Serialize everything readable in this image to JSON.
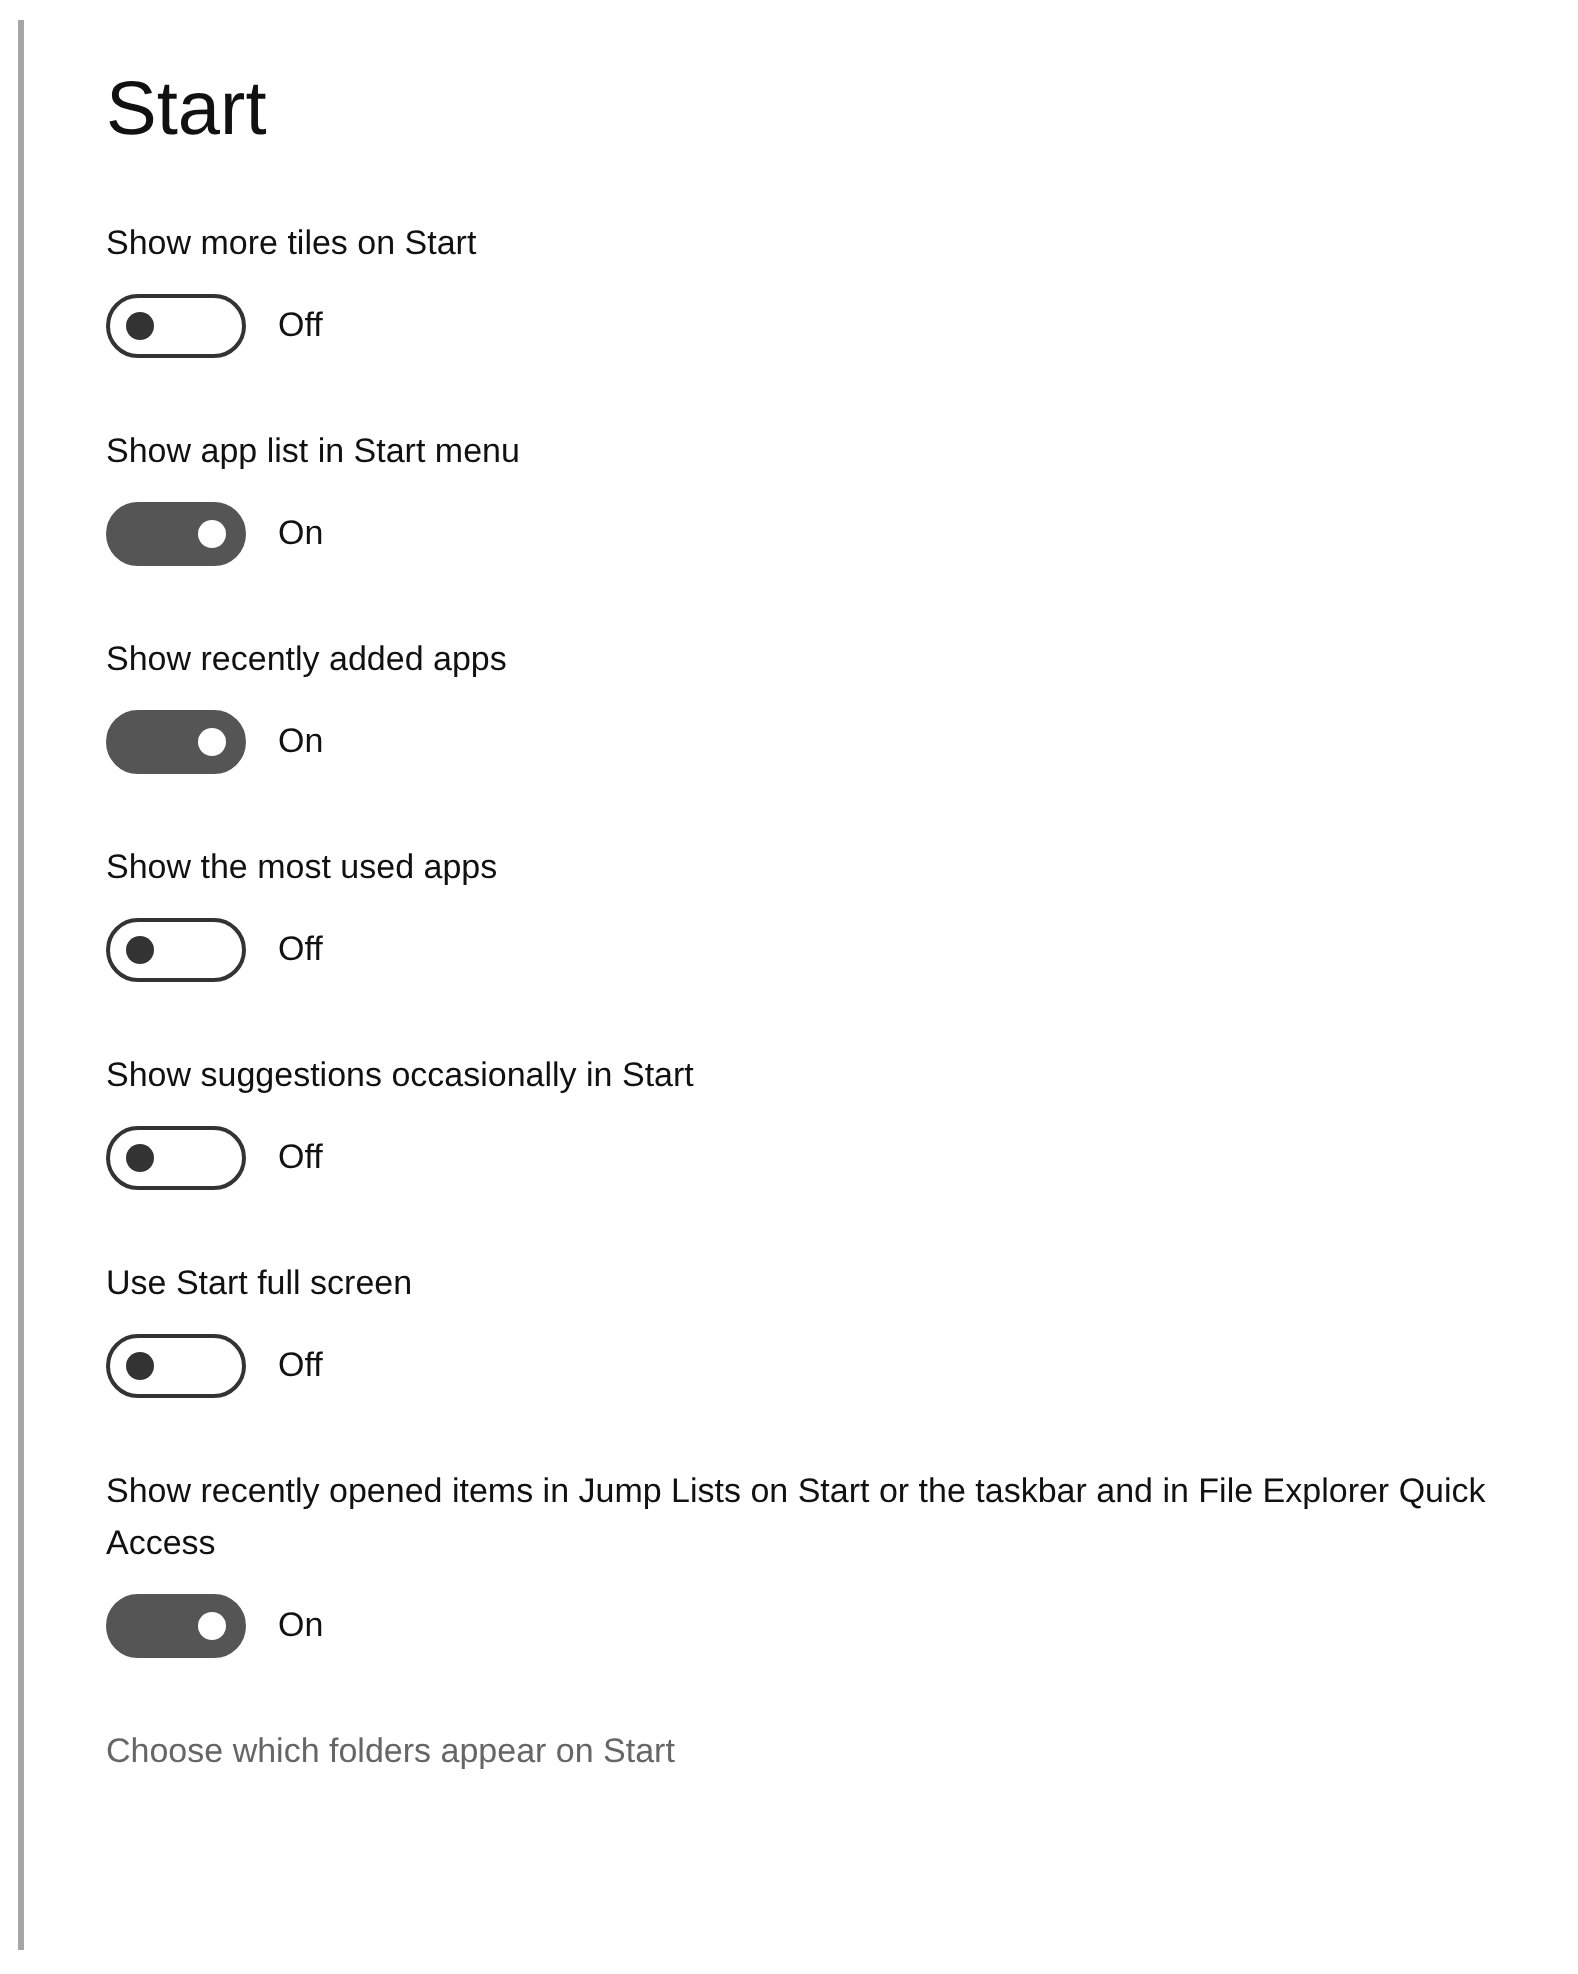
{
  "title": "Start",
  "settings": [
    {
      "label": "Show more tiles on Start",
      "on": false,
      "state_text": "Off"
    },
    {
      "label": "Show app list in Start menu",
      "on": true,
      "state_text": "On"
    },
    {
      "label": "Show recently added apps",
      "on": true,
      "state_text": "On"
    },
    {
      "label": "Show the most used apps",
      "on": false,
      "state_text": "Off"
    },
    {
      "label": "Show suggestions occasionally in Start",
      "on": false,
      "state_text": "Off"
    },
    {
      "label": "Use Start full screen",
      "on": false,
      "state_text": "Off"
    },
    {
      "label": "Show recently opened items in Jump Lists on Start or the taskbar and in File Explorer Quick Access",
      "on": true,
      "state_text": "On"
    }
  ],
  "link": "Choose which folders appear on Start"
}
